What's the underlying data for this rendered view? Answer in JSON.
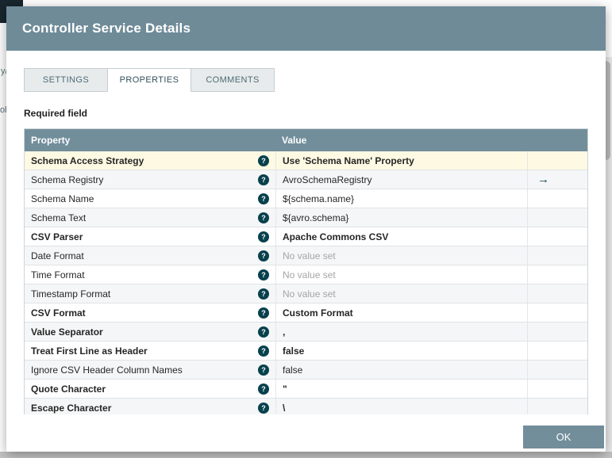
{
  "background": {
    "fragments": [
      "y/",
      "ol"
    ]
  },
  "dialog": {
    "title": "Controller Service Details",
    "required_field_label": "Required field"
  },
  "tabs": [
    {
      "label": "SETTINGS",
      "selected": false
    },
    {
      "label": "PROPERTIES",
      "selected": true
    },
    {
      "label": "COMMENTS",
      "selected": false
    }
  ],
  "table": {
    "columns": [
      "Property",
      "Value"
    ],
    "rows": [
      {
        "property": "Schema Access Strategy",
        "value": "Use 'Schema Name' Property",
        "required": true,
        "highlighted": true
      },
      {
        "property": "Schema Registry",
        "value": "AvroSchemaRegistry",
        "goto": true
      },
      {
        "property": "Schema Name",
        "value": "${schema.name}"
      },
      {
        "property": "Schema Text",
        "value": "${avro.schema}"
      },
      {
        "property": "CSV Parser",
        "value": "Apache Commons CSV",
        "required": true
      },
      {
        "property": "Date Format",
        "value": "No value set",
        "unset": true
      },
      {
        "property": "Time Format",
        "value": "No value set",
        "unset": true
      },
      {
        "property": "Timestamp Format",
        "value": "No value set",
        "unset": true
      },
      {
        "property": "CSV Format",
        "value": "Custom Format",
        "required": true
      },
      {
        "property": "Value Separator",
        "value": ",",
        "required": true
      },
      {
        "property": "Treat First Line as Header",
        "value": "false",
        "required": true
      },
      {
        "property": "Ignore CSV Header Column Names",
        "value": "false"
      },
      {
        "property": "Quote Character",
        "value": "\"",
        "required": true
      },
      {
        "property": "Escape Character",
        "value": "\\",
        "required": true
      }
    ]
  },
  "icons": {
    "help": "?",
    "goto": "→"
  },
  "footer": {
    "ok_label": "OK"
  },
  "colors": {
    "header": "#728e9b",
    "highlight_row": "#fdf9e3",
    "accent_dark": "#07414d"
  }
}
